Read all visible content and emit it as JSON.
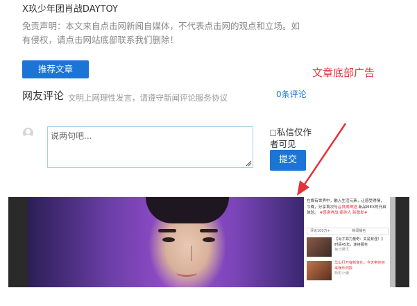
{
  "article": {
    "title_fragment": "X玖少年团肖战DAYTOY",
    "disclaimer": "免责声明：本文来自点击网新闻自媒体，不代表点击网的观点和立场。如有侵权，请点击网站底部联系我们删除！",
    "recommend_button": "推荐文章",
    "ad_label": "文章底部广告"
  },
  "comments": {
    "title": "网友评论",
    "hint": "文明上网理性发言，请遵守新闻评论服务协议",
    "count": "0条评论",
    "placeholder": "说两句吧...",
    "private_label": "私信仅作者可见",
    "submit": "提交"
  },
  "ad_screenshot": {
    "sidebar_text_1": "在娱有世界中，融入生活元素，让感受得情，今晚，分享首次与",
    "sidebar_text_hl": "@良威啤酒",
    "sidebar_text_2": " 新品MEX的开启体验。",
    "sidebar_text_3": "#感谢肖战 痛你人 新歌发#",
    "bar_left": "评论100万+",
    "bar_right": "新闻播名",
    "item1": "【肖子郑力量奇：失是有强！】时间45年，连续服务",
    "item1_sub": "每日娱讯",
    "item2": "华山打开有新变化，今天带你初来娱乐同款",
    "item2_sub": "新影小编"
  },
  "colors": {
    "accent": "#1c74d7",
    "ad_red": "#e2323a"
  }
}
